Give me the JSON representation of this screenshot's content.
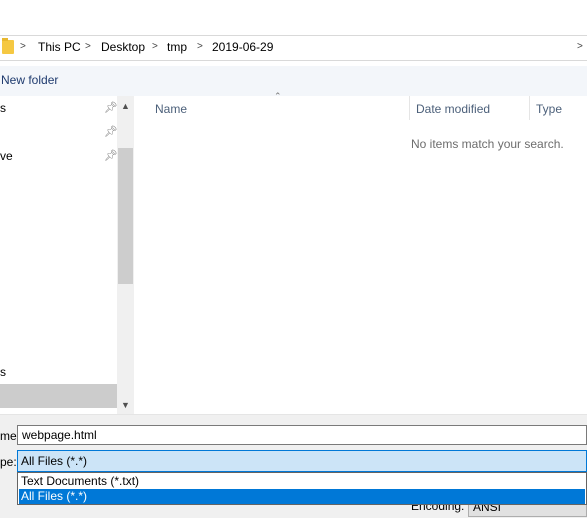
{
  "breadcrumb": {
    "items": [
      "This PC",
      "Desktop",
      "tmp",
      "2019-06-29"
    ],
    "separator": ">"
  },
  "toolbar": {
    "new_folder_label": "New folder"
  },
  "nav": {
    "items": [
      {
        "label": "s",
        "pinned": true
      },
      {
        "label": "",
        "pinned": true
      },
      {
        "label": "ve",
        "pinned": true
      },
      {
        "label": "s",
        "pinned": false
      }
    ]
  },
  "columns": {
    "name": "Name",
    "date_modified": "Date modified",
    "type": "Type"
  },
  "content": {
    "empty_message": "No items match your search."
  },
  "bottom": {
    "filename_label": "me:",
    "filename_value": "webpage.html",
    "filetype_label": "pe:",
    "filetype_value": "All Files  (*.*)",
    "filetype_options": [
      "Text Documents (*.txt)",
      "All Files  (*.*)"
    ],
    "encoding_label": "Encoding:",
    "encoding_value": "ANSI"
  },
  "icons": {
    "folder": "folder-icon",
    "pin": "pin-icon",
    "scroll_up": "chevron-up-icon",
    "scroll_down": "chevron-down-icon",
    "sort": "sort-indicator-icon"
  },
  "colors": {
    "selection": "#0078d7",
    "select_highlight": "#cce4f7",
    "toolbar_bg": "#f3f6fa",
    "link_text": "#1e3a6e"
  }
}
